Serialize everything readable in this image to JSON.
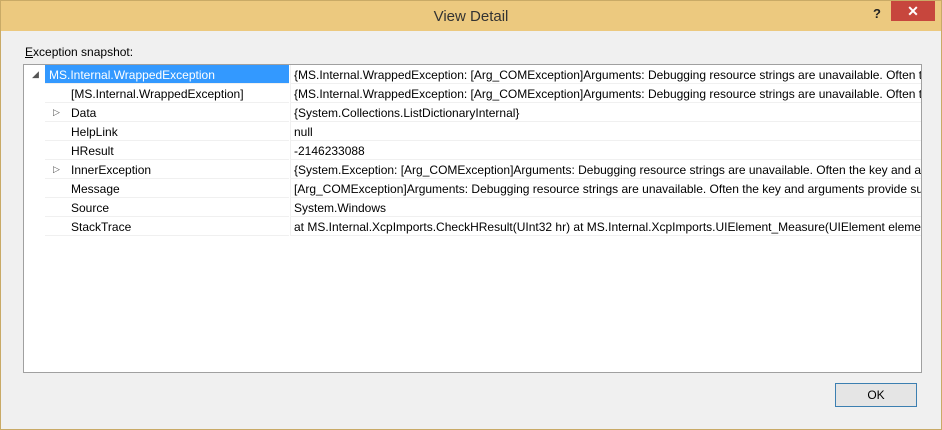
{
  "window": {
    "title": "View Detail",
    "help_label": "?",
    "close_label": "✕"
  },
  "section": {
    "label_mnemonic": "E",
    "label_rest": "xception snapshot:"
  },
  "rows": [
    {
      "name": "MS.Internal.WrappedException",
      "value": "{MS.Internal.WrappedException: [Arg_COMException]Arguments:  Debugging resource strings are unavailable. Often th",
      "expanded": true,
      "selected": true
    },
    {
      "name": "[MS.Internal.WrappedException]",
      "value": "{MS.Internal.WrappedException: [Arg_COMException]Arguments:  Debugging resource strings are unavailable. Often th"
    },
    {
      "name": "Data",
      "value": "{System.Collections.ListDictionaryInternal}",
      "expandable": true
    },
    {
      "name": "HelpLink",
      "value": "null"
    },
    {
      "name": "HResult",
      "value": "-2146233088"
    },
    {
      "name": "InnerException",
      "value": "{System.Exception: [Arg_COMException]Arguments:  Debugging resource strings are unavailable. Often the key and arg",
      "expandable": true
    },
    {
      "name": "Message",
      "value": "[Arg_COMException]Arguments:  Debugging resource strings are unavailable. Often the key and arguments provide suf"
    },
    {
      "name": "Source",
      "value": "System.Windows"
    },
    {
      "name": "StackTrace",
      "value": "   at MS.Internal.XcpImports.CheckHResult(UInt32 hr)    at MS.Internal.XcpImports.UIElement_Measure(UIElement eleme"
    }
  ],
  "buttons": {
    "ok": "OK"
  },
  "colors": {
    "titlebar": "#ecc97f",
    "selection": "#3399ff",
    "close": "#c7463d"
  }
}
